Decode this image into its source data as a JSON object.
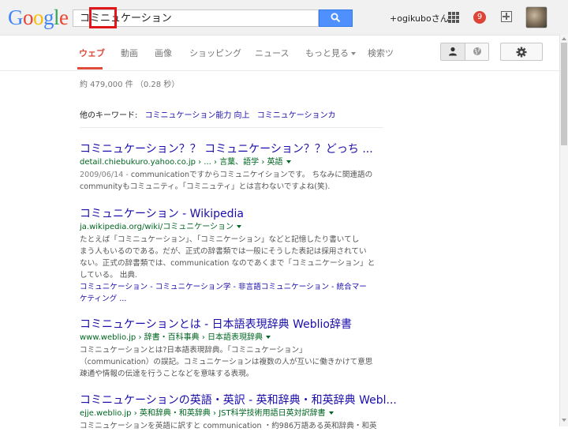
{
  "logo": {
    "letters": [
      "G",
      "o",
      "o",
      "g",
      "l",
      "e"
    ],
    "colors": [
      "#4285f4",
      "#ea4335",
      "#fbbc05",
      "#4285f4",
      "#34a853",
      "#ea4335"
    ]
  },
  "search": {
    "query": "コミニュケーション"
  },
  "header": {
    "user": "+ogikuboさん",
    "notifications": "9"
  },
  "tabs": [
    {
      "label": "ウェブ",
      "active": true
    },
    {
      "label": "動画"
    },
    {
      "label": "画像"
    },
    {
      "label": "ショッピング"
    },
    {
      "label": "ニュース"
    },
    {
      "label": "もっと見る"
    },
    {
      "label": "検索ツ"
    }
  ],
  "stats": "約 479,000 件 （0.28 秒）",
  "related": {
    "label": "他のキーワード:",
    "items": [
      "コミニュケーション能力 向上",
      "コミニュケーションカ"
    ]
  },
  "results": [
    {
      "title": "コミニュケーション？？ コミュニケーション？？どっち ...",
      "url": "detail.chiebukuro.yahoo.co.jp › ... › 言葉、語学 › 英語",
      "date": "2009/06/14 - ",
      "snippet": [
        "communicationですからコミュニケイションです。 ちなみに関連語の",
        "communityもコミュニティ。「コミニュティ」とは言わないですよね(笑)."
      ]
    },
    {
      "title": "コミュニケーション - Wikipedia",
      "url": "ja.wikipedia.org/wiki/コミュニケーション",
      "snippet": [
        "たとえば「コミニュケーション」、「コミニケーション」などと記憶したり書いてし",
        "まう人もいるのである。だが、正式の辞書類では一般にそうした表記は採用されてい",
        "ない。正式の辞書類では、communication なのであくまで「コミュニケーション」と",
        "している。 出典."
      ],
      "links": [
        "コミュニケーション - コミュニケーション学 - 非言語コミュニケーション - 統合マー",
        "ケティング ..."
      ]
    },
    {
      "title": "コミニュケーションとは - 日本語表現辞典 Weblio辞書",
      "url": "www.weblio.jp › 辞書・百科事典 › 日本語表現辞典",
      "snippet": [
        "コミニュケーションとは?日本語表現辞典。「コミニュケーション」",
        "（communication）の誤記。コミュニケーションは複数の人が互いに働きかけて意思",
        "疎通や情報の伝達を行うことなどを意味する表現。"
      ]
    },
    {
      "title": "コミニュケーションの英語・英訳 - 英和辞典・和英辞典 Webl...",
      "url": "ejje.weblio.jp › 英和辞典・和英辞典 › JST科学技術用語日英対訳辞書",
      "snippet": [
        "コミニュケーションを英語に訳すと communication ・約986万語ある英和辞典・和英"
      ]
    }
  ]
}
